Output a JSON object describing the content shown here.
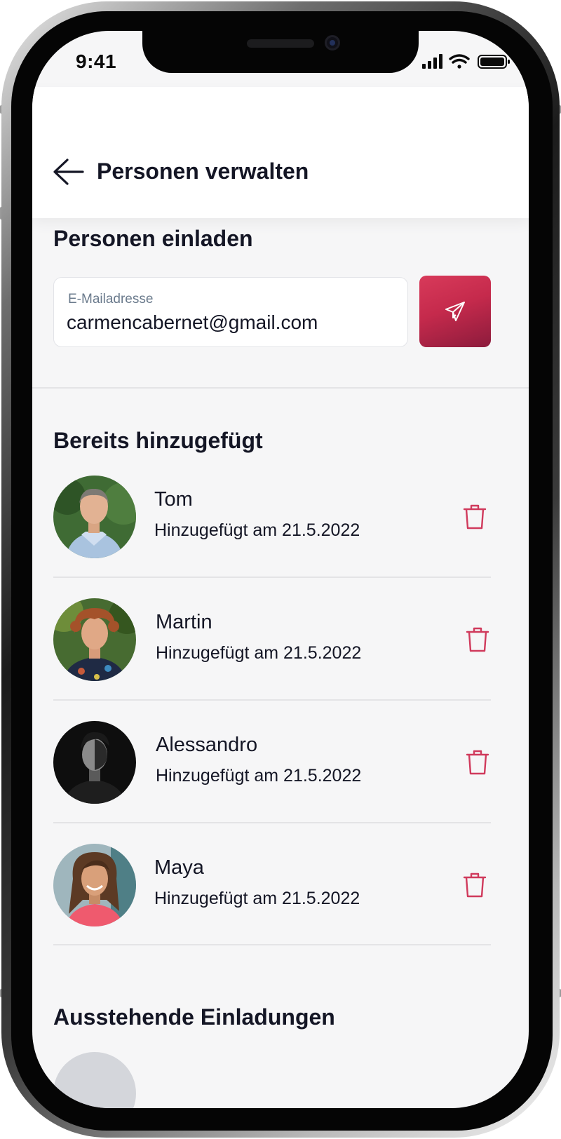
{
  "status_bar": {
    "time": "9:41"
  },
  "header": {
    "title": "Personen verwalten",
    "back_icon": "arrow-left-icon"
  },
  "invite": {
    "title": "Personen einladen",
    "email_label": "E-Mailadresse",
    "email_value": "carmencabernet@gmail.com",
    "send_icon": "paper-plane-icon"
  },
  "added": {
    "title": "Bereits hinzugefügt",
    "people": [
      {
        "name": "Tom",
        "date": "Hinzugefügt am 21.5.2022",
        "delete_icon": "trash-icon"
      },
      {
        "name": "Martin",
        "date": "Hinzugefügt am 21.5.2022",
        "delete_icon": "trash-icon"
      },
      {
        "name": "Alessandro",
        "date": "Hinzugefügt am 21.5.2022",
        "delete_icon": "trash-icon"
      },
      {
        "name": "Maya",
        "date": "Hinzugefügt am 21.5.2022",
        "delete_icon": "trash-icon"
      }
    ]
  },
  "pending": {
    "title": "Ausstehende Einladungen"
  },
  "colors": {
    "accent": "#C52A4C",
    "accent_dark": "#8C1B3C",
    "text": "#141625",
    "background": "#F6F6F7"
  }
}
